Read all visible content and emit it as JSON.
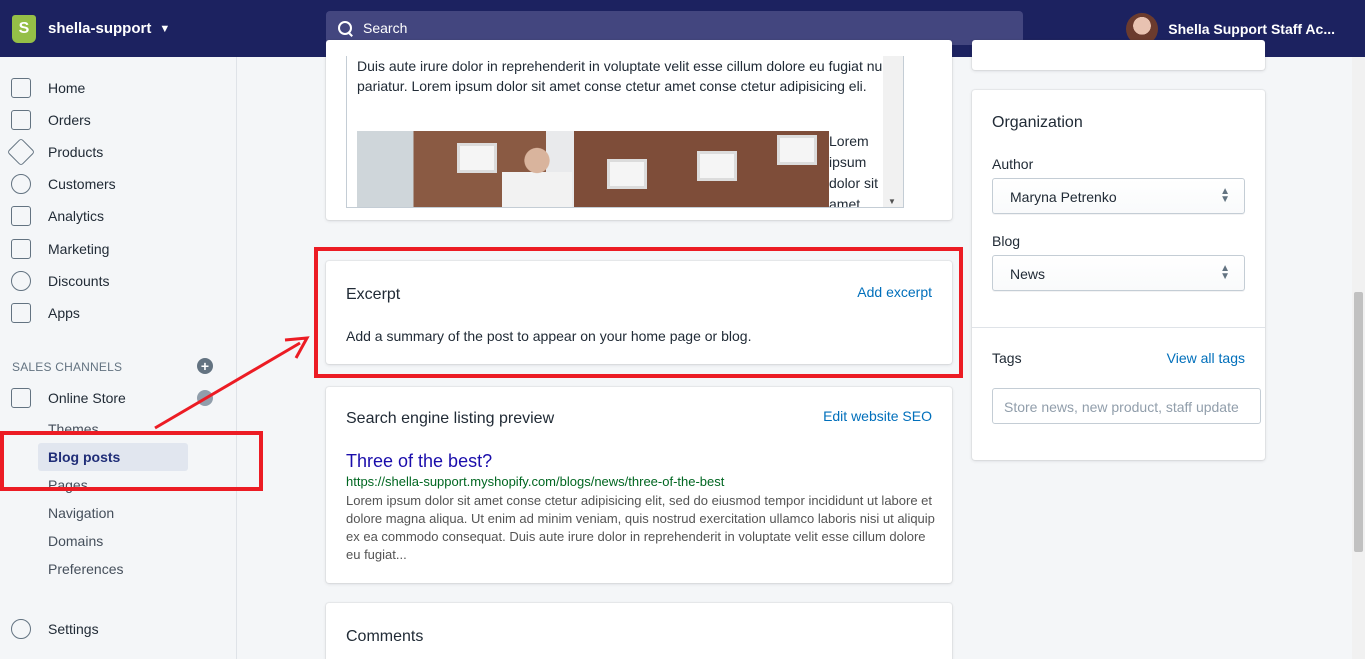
{
  "topbar": {
    "shop_name": "shella-support",
    "search_placeholder": "Search",
    "account_name": "Shella Support Staff Ac..."
  },
  "sidebar": {
    "items": [
      {
        "label": "Home",
        "icon": "home-icon"
      },
      {
        "label": "Orders",
        "icon": "orders-icon"
      },
      {
        "label": "Products",
        "icon": "tag-icon"
      },
      {
        "label": "Customers",
        "icon": "person-icon"
      },
      {
        "label": "Analytics",
        "icon": "bar-chart-icon"
      },
      {
        "label": "Marketing",
        "icon": "megaphone-icon"
      },
      {
        "label": "Discounts",
        "icon": "discount-icon"
      },
      {
        "label": "Apps",
        "icon": "apps-icon"
      }
    ],
    "sales_channels_title": "SALES CHANNELS",
    "online_store": "Online Store",
    "sub_items": [
      "Themes",
      "Blog posts",
      "Pages",
      "Navigation",
      "Domains",
      "Preferences"
    ],
    "settings": "Settings"
  },
  "editor": {
    "text": "Duis aute irure dolor in reprehenderit in voluptate velit esse cillum dolore eu fugiat nulla pariatur. Lorem ipsum dolor sit amet conse ctetur amet conse ctetur adipisicing eli.",
    "side_lines": [
      "Lorem",
      "ipsum",
      "dolor sit",
      "amet"
    ]
  },
  "excerpt": {
    "title": "Excerpt",
    "link": "Add excerpt",
    "text": "Add a summary of the post to appear on your home page or blog."
  },
  "seo": {
    "title": "Search engine listing preview",
    "link": "Edit website SEO",
    "preview_title": "Three of the best?",
    "preview_url": "https://shella-support.myshopify.com/blogs/news/three-of-the-best",
    "preview_desc": "Lorem ipsum dolor sit amet conse ctetur adipisicing elit, sed do eiusmod tempor incididunt ut labore et dolore magna aliqua. Ut enim ad minim veniam, quis nostrud exercitation ullamco laboris nisi ut aliquip ex ea commodo consequat. Duis aute irure dolor in reprehenderit in voluptate velit esse cillum dolore eu fugiat..."
  },
  "comments": {
    "title": "Comments"
  },
  "organization": {
    "title": "Organization",
    "author_label": "Author",
    "author_value": "Maryna Petrenko",
    "blog_label": "Blog",
    "blog_value": "News",
    "tags_label": "Tags",
    "tags_link": "View all tags",
    "tags_placeholder": "Store news, new product, staff update"
  },
  "colors": {
    "topbar": "#1c2260",
    "link": "#006fbb",
    "annotation": "#ec1c24"
  }
}
